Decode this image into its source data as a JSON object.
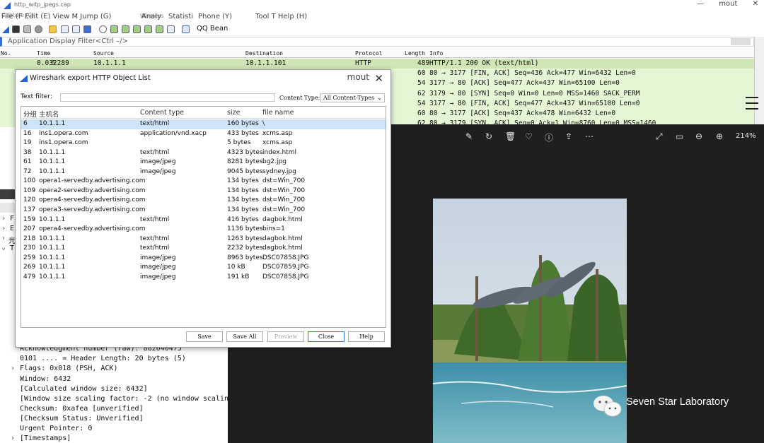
{
  "window": {
    "title": "http_witp_jpegs.cap",
    "buttons": [
      "—",
      "mout",
      "✕"
    ]
  },
  "menu": {
    "items": [
      "File (F Edit (E) View M Jump (G)",
      "Analy",
      "Statisti",
      "Phone (Y)",
      "Tool T Help (H)"
    ],
    "overlay": [
      "Capture (C)",
      "Wireless"
    ]
  },
  "toolbar": {
    "label": "QQ Bean"
  },
  "filter": {
    "placeholder": "Application Display Filter<Ctrl –/>"
  },
  "packet_list": {
    "columns": [
      "No.",
      "Time",
      "Source",
      "Destination",
      "Protocol",
      "Length",
      "Info"
    ],
    "rows": [
      {
        "no": "6",
        "time": "0.032289",
        "src": "10.1.1.1",
        "dst": "10.1.1.101",
        "proto": "HTTP",
        "len": "489",
        "info": "HTTP/1.1 200 OK  (text/html)"
      },
      {
        "no": "",
        "time": "",
        "src": "",
        "dst": "",
        "proto": "",
        "len": "60",
        "info": "80 → 3177 [FIN, ACK] Seq=436 Ack=477 Win=6432 Len=0"
      },
      {
        "no": "",
        "time": "",
        "src": "",
        "dst": "",
        "proto": "",
        "len": "54",
        "info": "3177 → 80 [ACK] Seq=477 Ack=437 Win=65100 Len=0"
      },
      {
        "no": "",
        "time": "",
        "src": "",
        "dst": "",
        "proto": "",
        "len": "62",
        "info": "3179 → 80 [SYN] Seq=0 Win=0 Len=0 MSS=1460 SACK_PERM"
      },
      {
        "no": "",
        "time": "",
        "src": "",
        "dst": "",
        "proto": "",
        "len": "54",
        "info": "3177 → 80 [FIN, ACK] Seq=477 Ack=437 Win=65100 Len=0"
      },
      {
        "no": "",
        "time": "",
        "src": "",
        "dst": "",
        "proto": "",
        "len": "60",
        "info": "80 → 3177 [ACK] Seq=437 Ack=478 Win=6432 Len=0"
      },
      {
        "no": "",
        "time": "",
        "src": "",
        "dst": "",
        "proto": "",
        "len": "62",
        "info": "80 → 3179 [SYN, ACK] Seq=0 Ack=1 Win=8760 Len=0 MSS=1460"
      }
    ]
  },
  "tree_side": [
    "F",
    "E",
    "光",
    "T"
  ],
  "details": [
    "Acknowledgment number (raw): 882640475",
    "0101 .... = Header Length: 20 bytes (5)",
    "Flags: 0x018 (PSH, ACK)",
    "Window: 6432",
    "[Calculated window size: 6432]",
    "[Window size scaling factor: -2 (no window scaling u",
    "Checksum: 0xafea [unverified]",
    "[Checksum Status: Unverified]",
    "Urgent Pointer: 0",
    "[Timestamps]"
  ],
  "dialog": {
    "title": "Wireshark export HTTP Object List",
    "maximize": "mout",
    "close": "✕",
    "text_filter_label": "Text filter:",
    "content_type_label": "Content Type:",
    "content_type_value": "All Content-Types",
    "columns": [
      "分组",
      "主机名",
      "Content type",
      "size",
      "file name"
    ],
    "rows": [
      {
        "packet": "6",
        "host": "10.1.1.1",
        "type": "text/html",
        "size": "160 bytes",
        "file": "\\"
      },
      {
        "packet": "16",
        "host": "ins1.opera.com",
        "type": "application/vnd.xacp",
        "size": "433 bytes",
        "file": "xcms.asp"
      },
      {
        "packet": "19",
        "host": "ins1.opera.com",
        "type": "",
        "size": "5 bytes",
        "file": "xcms.asp"
      },
      {
        "packet": "38",
        "host": "10.1.1.1",
        "type": "text/html",
        "size": "4323 bytes",
        "file": "index.html"
      },
      {
        "packet": "61",
        "host": "10.1.1.1",
        "type": "image/jpeg",
        "size": "8281 bytes",
        "file": "bg2.jpg"
      },
      {
        "packet": "72",
        "host": "10.1.1.1",
        "type": "image/jpeg",
        "size": "9045 bytes",
        "file": "sydney.jpg"
      },
      {
        "packet": "100",
        "host": "opera1-servedby.advertising.com",
        "type": "",
        "size": "134 bytes",
        "file": "dst=Win_700"
      },
      {
        "packet": "109",
        "host": "opera2-servedby.advertising.com",
        "type": "",
        "size": "134 bytes",
        "file": "dst=Win_700"
      },
      {
        "packet": "120",
        "host": "opera4-servedby.advertising.com",
        "type": "",
        "size": "134 bytes",
        "file": "dst=Win_700"
      },
      {
        "packet": "137",
        "host": "opera3-servedby.advertising.com",
        "type": "",
        "size": "134 bytes",
        "file": "dst=Win_700"
      },
      {
        "packet": "159",
        "host": "10.1.1.1",
        "type": "text/html",
        "size": "416 bytes",
        "file": "dagbok.html"
      },
      {
        "packet": "207",
        "host": "opera4-servedby.advertising.com",
        "type": "",
        "size": "1136 bytes",
        "file": "bins=1"
      },
      {
        "packet": "218",
        "host": "10.1.1.1",
        "type": "text/html",
        "size": "1263 bytes",
        "file": "dagbok.html"
      },
      {
        "packet": "230",
        "host": "10.1.1.1",
        "type": "text/html",
        "size": "2232 bytes",
        "file": "dagbok.html"
      },
      {
        "packet": "259",
        "host": "10.1.1.1",
        "type": "image/jpeg",
        "size": "8963 bytes",
        "file": "DSC07858.JPG"
      },
      {
        "packet": "269",
        "host": "10.1.1.1",
        "type": "image/jpeg",
        "size": "10 kB",
        "file": "DSC07859.JPG"
      },
      {
        "packet": "479",
        "host": "10.1.1.1",
        "type": "image/jpeg",
        "size": "191 kB",
        "file": "DSC07858.JPG"
      }
    ],
    "buttons": {
      "save": "Save",
      "save_all": "Save All",
      "preview": "Preview",
      "close": "Close",
      "help": "Help"
    }
  },
  "viewer": {
    "zoom": "214%",
    "toolbar_icons": [
      "edit-icon",
      "rotate-icon",
      "delete-icon",
      "heart-icon",
      "info-icon",
      "share-icon",
      "more-icon",
      "expand-icon",
      "fit-icon",
      "zoom-out-icon",
      "zoom-in-icon"
    ]
  },
  "watermark": {
    "text": "Seven Star Laboratory"
  },
  "colors": {
    "packet_bg": "#e5f6d5",
    "accent": "#2a6fd6",
    "viewer_bg": "#1f1f1f"
  }
}
